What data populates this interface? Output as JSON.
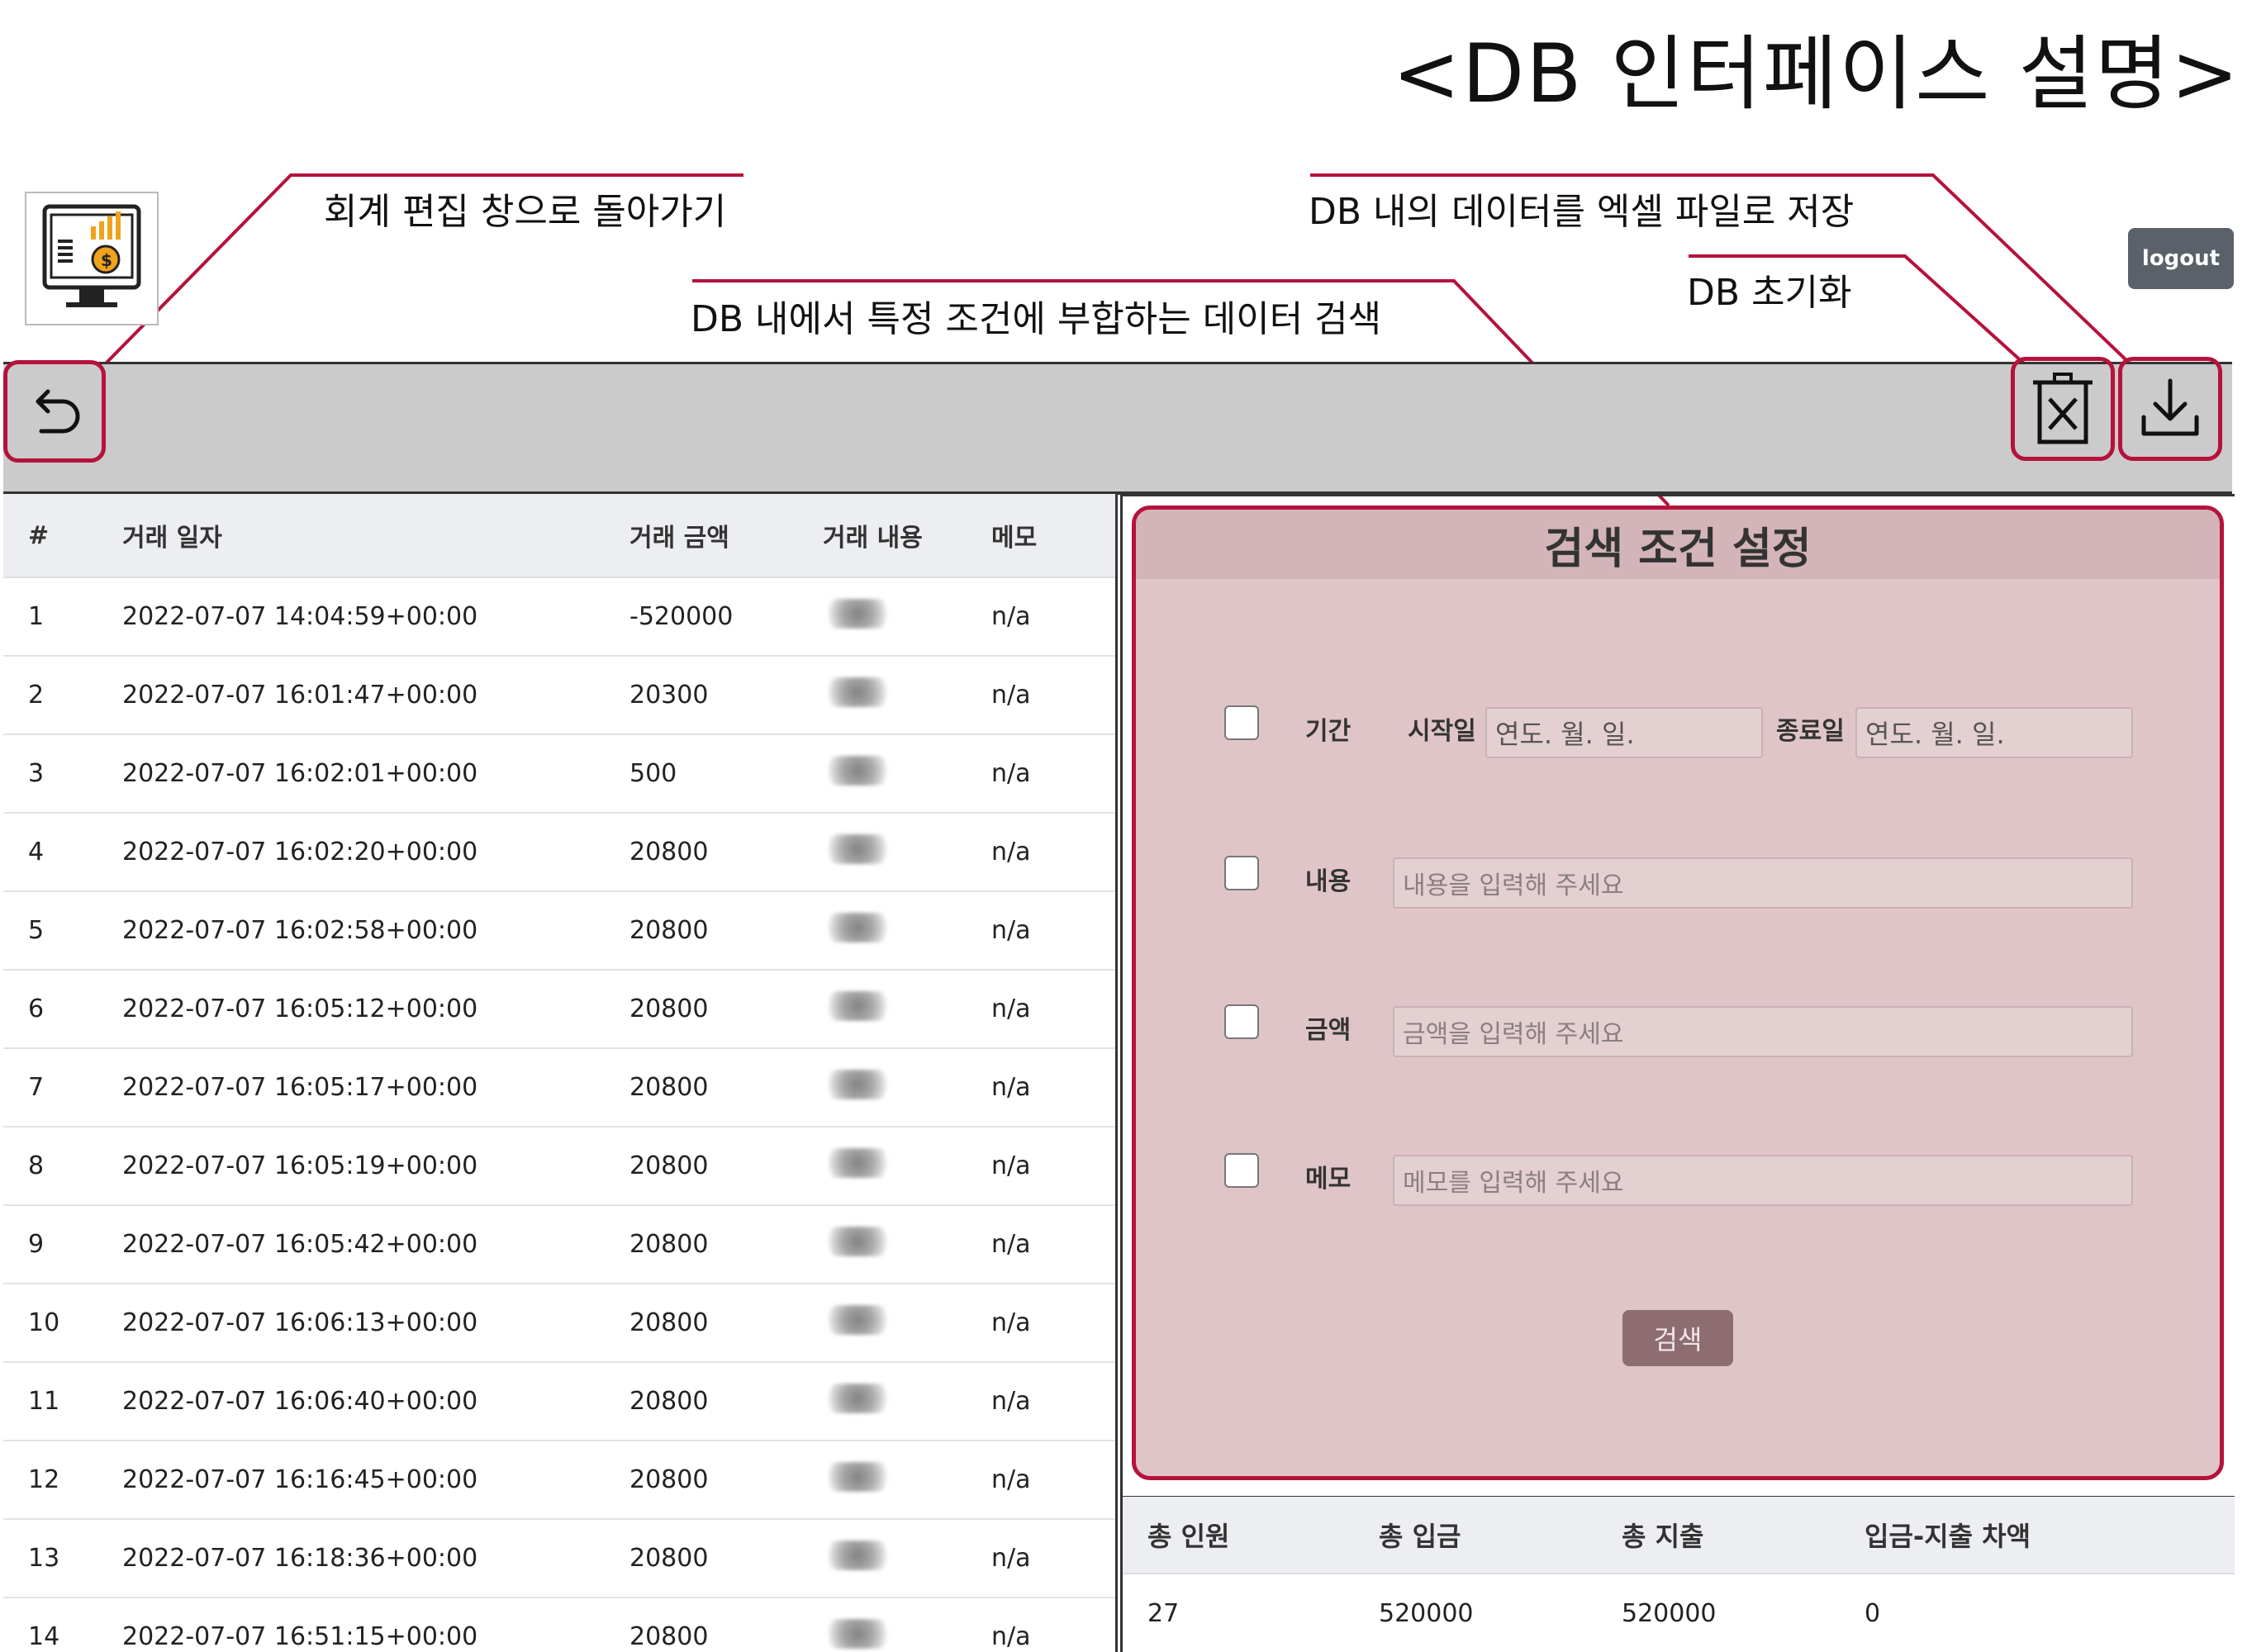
{
  "page_title": "<DB 인터페이스 설명>",
  "annotations": {
    "back": "회계 편집 창으로 돌아가기",
    "export": "DB 내의 데이터를 엑셀 파일로 저장",
    "search": "DB 내에서 특정 조건에 부합하는 데이터 검색",
    "reset": "DB 초기화"
  },
  "logout_label": "logout",
  "icons": {
    "logo": "accounting-monitor-icon",
    "back": "undo-arrow-icon",
    "reset": "trash-x-icon",
    "export": "download-icon"
  },
  "colors": {
    "highlight": "#b5123c",
    "search_panel_bg": "#e0c5c8",
    "toolbar_bg": "#cbcbcb"
  },
  "table": {
    "headers": [
      "#",
      "거래 일자",
      "거래 금액",
      "거래 내용",
      "메모"
    ],
    "rows": [
      {
        "num": "1",
        "date": "2022-07-07 14:04:59+00:00",
        "amount": "-520000",
        "memo": "n/a"
      },
      {
        "num": "2",
        "date": "2022-07-07 16:01:47+00:00",
        "amount": "20300",
        "memo": "n/a"
      },
      {
        "num": "3",
        "date": "2022-07-07 16:02:01+00:00",
        "amount": "500",
        "memo": "n/a"
      },
      {
        "num": "4",
        "date": "2022-07-07 16:02:20+00:00",
        "amount": "20800",
        "memo": "n/a"
      },
      {
        "num": "5",
        "date": "2022-07-07 16:02:58+00:00",
        "amount": "20800",
        "memo": "n/a"
      },
      {
        "num": "6",
        "date": "2022-07-07 16:05:12+00:00",
        "amount": "20800",
        "memo": "n/a"
      },
      {
        "num": "7",
        "date": "2022-07-07 16:05:17+00:00",
        "amount": "20800",
        "memo": "n/a"
      },
      {
        "num": "8",
        "date": "2022-07-07 16:05:19+00:00",
        "amount": "20800",
        "memo": "n/a"
      },
      {
        "num": "9",
        "date": "2022-07-07 16:05:42+00:00",
        "amount": "20800",
        "memo": "n/a"
      },
      {
        "num": "10",
        "date": "2022-07-07 16:06:13+00:00",
        "amount": "20800",
        "memo": "n/a"
      },
      {
        "num": "11",
        "date": "2022-07-07 16:06:40+00:00",
        "amount": "20800",
        "memo": "n/a"
      },
      {
        "num": "12",
        "date": "2022-07-07 16:16:45+00:00",
        "amount": "20800",
        "memo": "n/a"
      },
      {
        "num": "13",
        "date": "2022-07-07 16:18:36+00:00",
        "amount": "20800",
        "memo": "n/a"
      },
      {
        "num": "14",
        "date": "2022-07-07 16:51:15+00:00",
        "amount": "20800",
        "memo": "n/a"
      }
    ]
  },
  "search": {
    "title": "검색 조건 설정",
    "period_label": "기간",
    "start_label": "시작일",
    "end_label": "종료일",
    "date_placeholder": "연도. 월. 일.",
    "content_label": "내용",
    "content_placeholder": "내용을 입력해 주세요",
    "amount_label": "금액",
    "amount_placeholder": "금액을 입력해 주세요",
    "memo_label": "메모",
    "memo_placeholder": "메모를 입력해 주세요",
    "button": "검색"
  },
  "summary": {
    "headers": [
      "총 인원",
      "총 입금",
      "총 지출",
      "입금-지출 차액"
    ],
    "values": [
      "27",
      "520000",
      "520000",
      "0"
    ]
  }
}
